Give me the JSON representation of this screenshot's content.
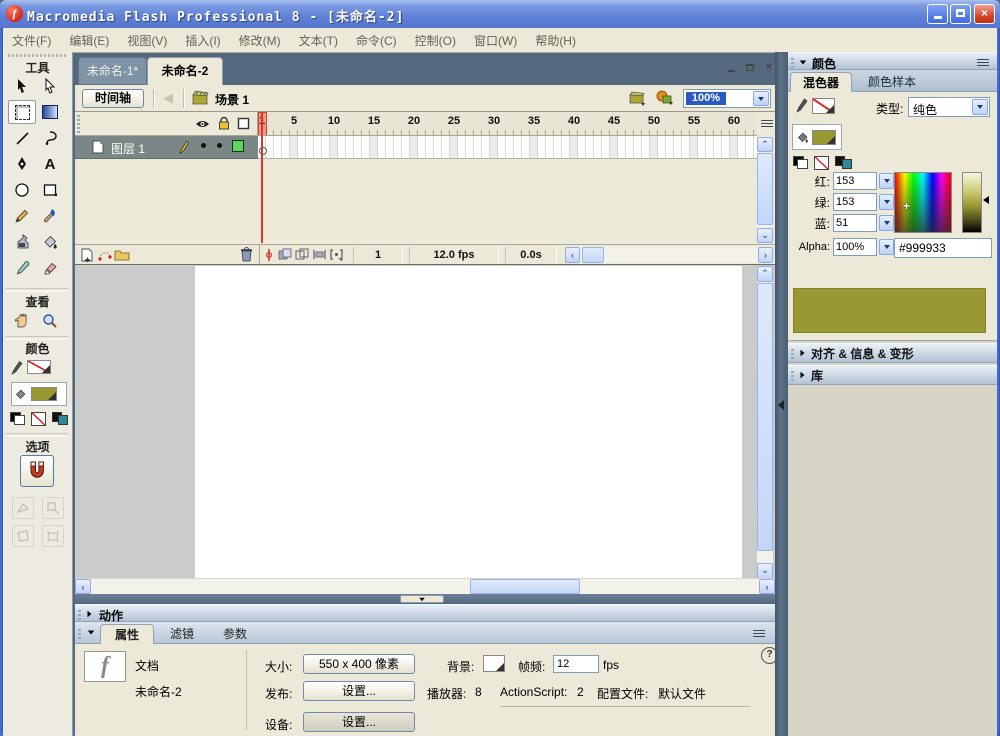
{
  "colors": {
    "fill_color": "#999933",
    "stage_background": "#ffffff",
    "layer_outline_color": "#5fd35f",
    "playhead_color": "#d63a2f",
    "titlebar_accent": "#5f80d6",
    "panel_beige": "#ece9d8"
  },
  "window": {
    "title": "Macromedia Flash Professional 8 - [未命名-2]",
    "close_glyph": "×"
  },
  "menu": {
    "items": [
      "文件(F)",
      "编辑(E)",
      "视图(V)",
      "插入(I)",
      "修改(M)",
      "文本(T)",
      "命令(C)",
      "控制(O)",
      "窗口(W)",
      "帮助(H)"
    ]
  },
  "tools_panel": {
    "tools_title": "工具",
    "view_title": "查看",
    "colors_title": "颜色",
    "options_title": "选项",
    "text_tool_label": "A"
  },
  "document": {
    "tabs": [
      {
        "label": "未命名-1*"
      },
      {
        "label": "未命名-2"
      }
    ],
    "timeline_button": "时间轴",
    "scene_name": "场景 1",
    "zoom_value": "100%",
    "back_glyph": "◀"
  },
  "timeline": {
    "layer_name": "图层 1",
    "ruler_numbers": [
      "1",
      "5",
      "10",
      "15",
      "20",
      "25",
      "30",
      "35",
      "40",
      "45",
      "50",
      "55",
      "60"
    ],
    "current_frame": "1",
    "frame_rate": "12.0 fps",
    "elapsed_time": "0.0s"
  },
  "actions_panel": {
    "title": "动作"
  },
  "properties_panel": {
    "tabs": [
      "属性",
      "滤镜",
      "参数"
    ],
    "doc_type": "文档",
    "doc_name": "未命名-2",
    "size_label": "大小:",
    "size_value": "550 x 400 像素",
    "background_label": "背景:",
    "framerate_label": "帧频:",
    "framerate_value": "12",
    "framerate_unit": "fps",
    "publish_label": "发布:",
    "publish_button": "设置...",
    "player_label": "播放器:",
    "player_value": "8",
    "actionscript_label": "ActionScript:",
    "actionscript_value": "2",
    "profile_label": "配置文件:",
    "profile_value": "默认文件",
    "device_label": "设备:",
    "device_button": "设置...",
    "help_glyph": "?"
  },
  "color_panel": {
    "title": "颜色",
    "tabs": [
      "混色器",
      "颜色样本"
    ],
    "type_label": "类型:",
    "type_value": "纯色",
    "red_label": "红:",
    "red_value": "153",
    "green_label": "绿:",
    "green_value": "153",
    "blue_label": "蓝:",
    "blue_value": "51",
    "alpha_label": "Alpha:",
    "alpha_value": "100%",
    "hex_value": "#999933"
  },
  "align_panel": {
    "title": "对齐 & 信息 & 变形"
  },
  "library_panel": {
    "title": "库"
  }
}
